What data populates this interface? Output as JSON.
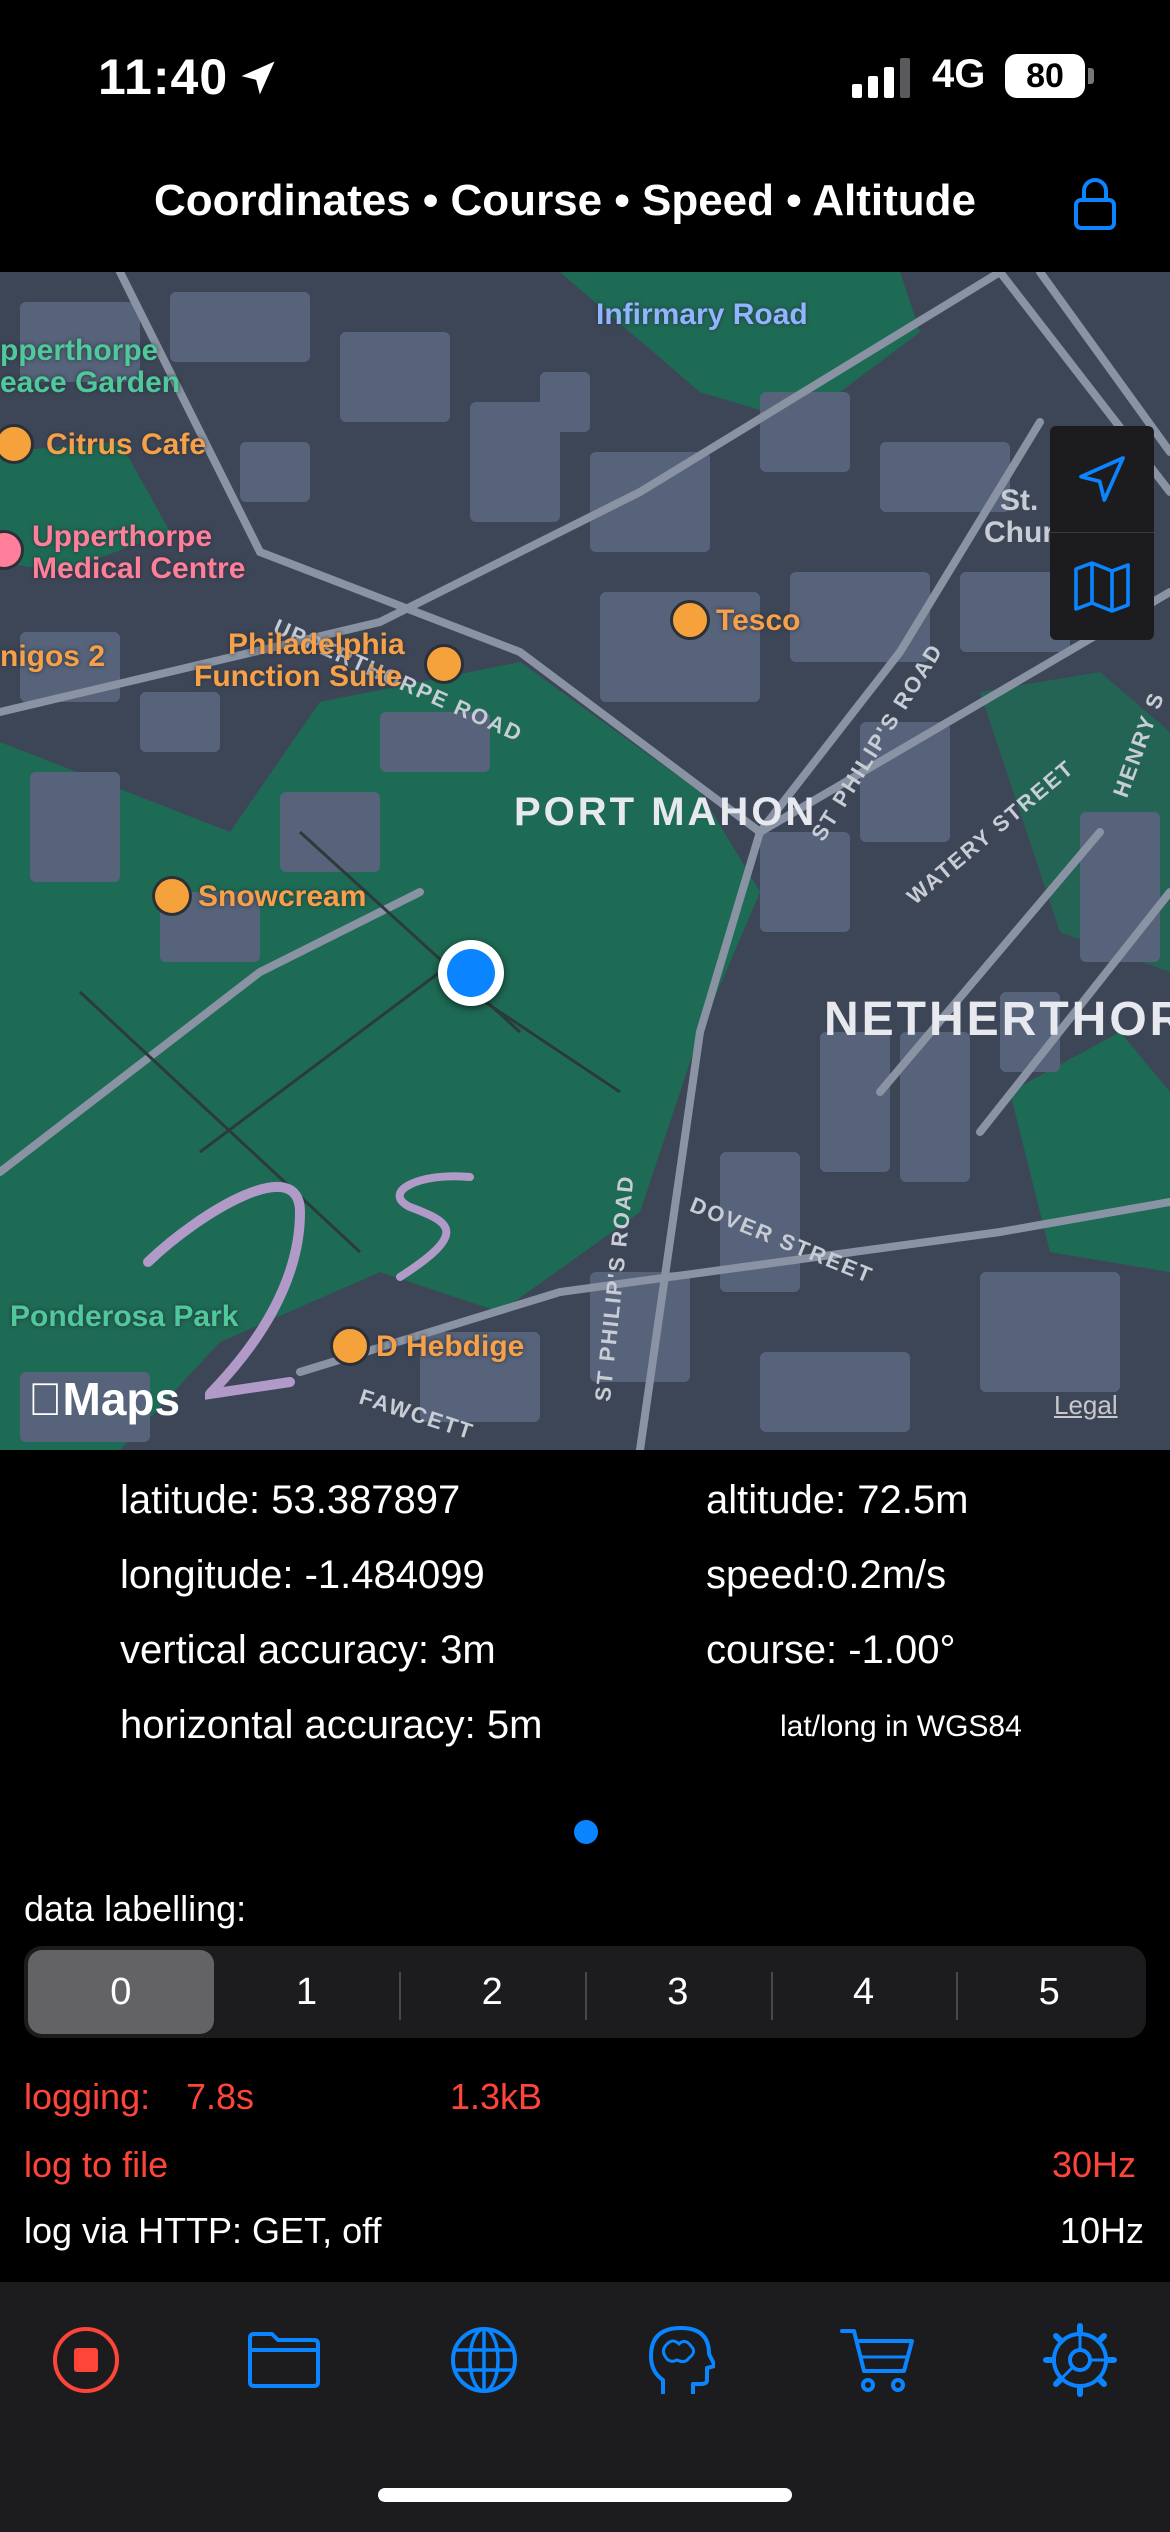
{
  "status_bar": {
    "time": "11:40",
    "network": "4G",
    "battery": "80"
  },
  "header": {
    "title": "Coordinates • Course • Speed • Altitude"
  },
  "map": {
    "labels": {
      "infirmary_road": "Infirmary Road",
      "upperthorpe_garden_1": "pperthorpe",
      "upperthorpe_garden_2": "eace Garden",
      "citrus_cafe": "Citrus Cafe",
      "medical_1": "Upperthorpe",
      "medical_2": "Medical Centre",
      "upperthorpe_road": "UPPERTHORPE ROAD",
      "tesco": "Tesco",
      "st_churchyard_1": "St.",
      "st_churchyard_2": "Churchyard",
      "migos": "nigos 2",
      "philadelphia_1": "Philadelphia",
      "philadelphia_2": "Function Suite",
      "port_mahon": "PORT MAHON",
      "st_philips_road_1": "ST PHILIP'S ROAD",
      "watery_street": "WATERY STREET",
      "henry": "HENRY S",
      "snowcream": "Snowcream",
      "netherthorpe": "NETHERTHORPE",
      "st_philips_road_2": "ST PHILIP'S ROAD",
      "dover_street": "DOVER STREET",
      "ponderosa": "Ponderosa Park",
      "hebdige": "D Hebdige",
      "fawcett": "FAWCETT"
    },
    "brand": "Maps",
    "legal": "Legal",
    "colors": {
      "park": "#1e6b55",
      "block": "#56637a",
      "road": "#8a93a3",
      "water": "#3b4452"
    }
  },
  "readout": {
    "latitude": "latitude: 53.387897",
    "longitude": "longitude: -1.484099",
    "vertical_accuracy": "vertical accuracy: 3m",
    "horizontal_accuracy": "horizontal accuracy: 5m",
    "altitude": "altitude: 72.5m",
    "speed": "speed:0.2m/s",
    "course": "course: -1.00°",
    "datum": "lat/long in WGS84"
  },
  "labelling": {
    "label": "data labelling:",
    "options": [
      "0",
      "1",
      "2",
      "3",
      "4",
      "5"
    ],
    "selected": "0"
  },
  "logging": {
    "logging_label": "logging:",
    "duration": "7.8s",
    "size": "1.3kB",
    "log_to_file": "log to file",
    "file_rate": "30Hz",
    "http": "log via HTTP: GET, off",
    "http_rate": "10Hz"
  },
  "tabs": [
    "record-icon",
    "folder-icon",
    "globe-icon",
    "brain-icon",
    "cart-icon",
    "gear-icon"
  ],
  "accent": "#0a84ff",
  "record_color": "#ff453a"
}
